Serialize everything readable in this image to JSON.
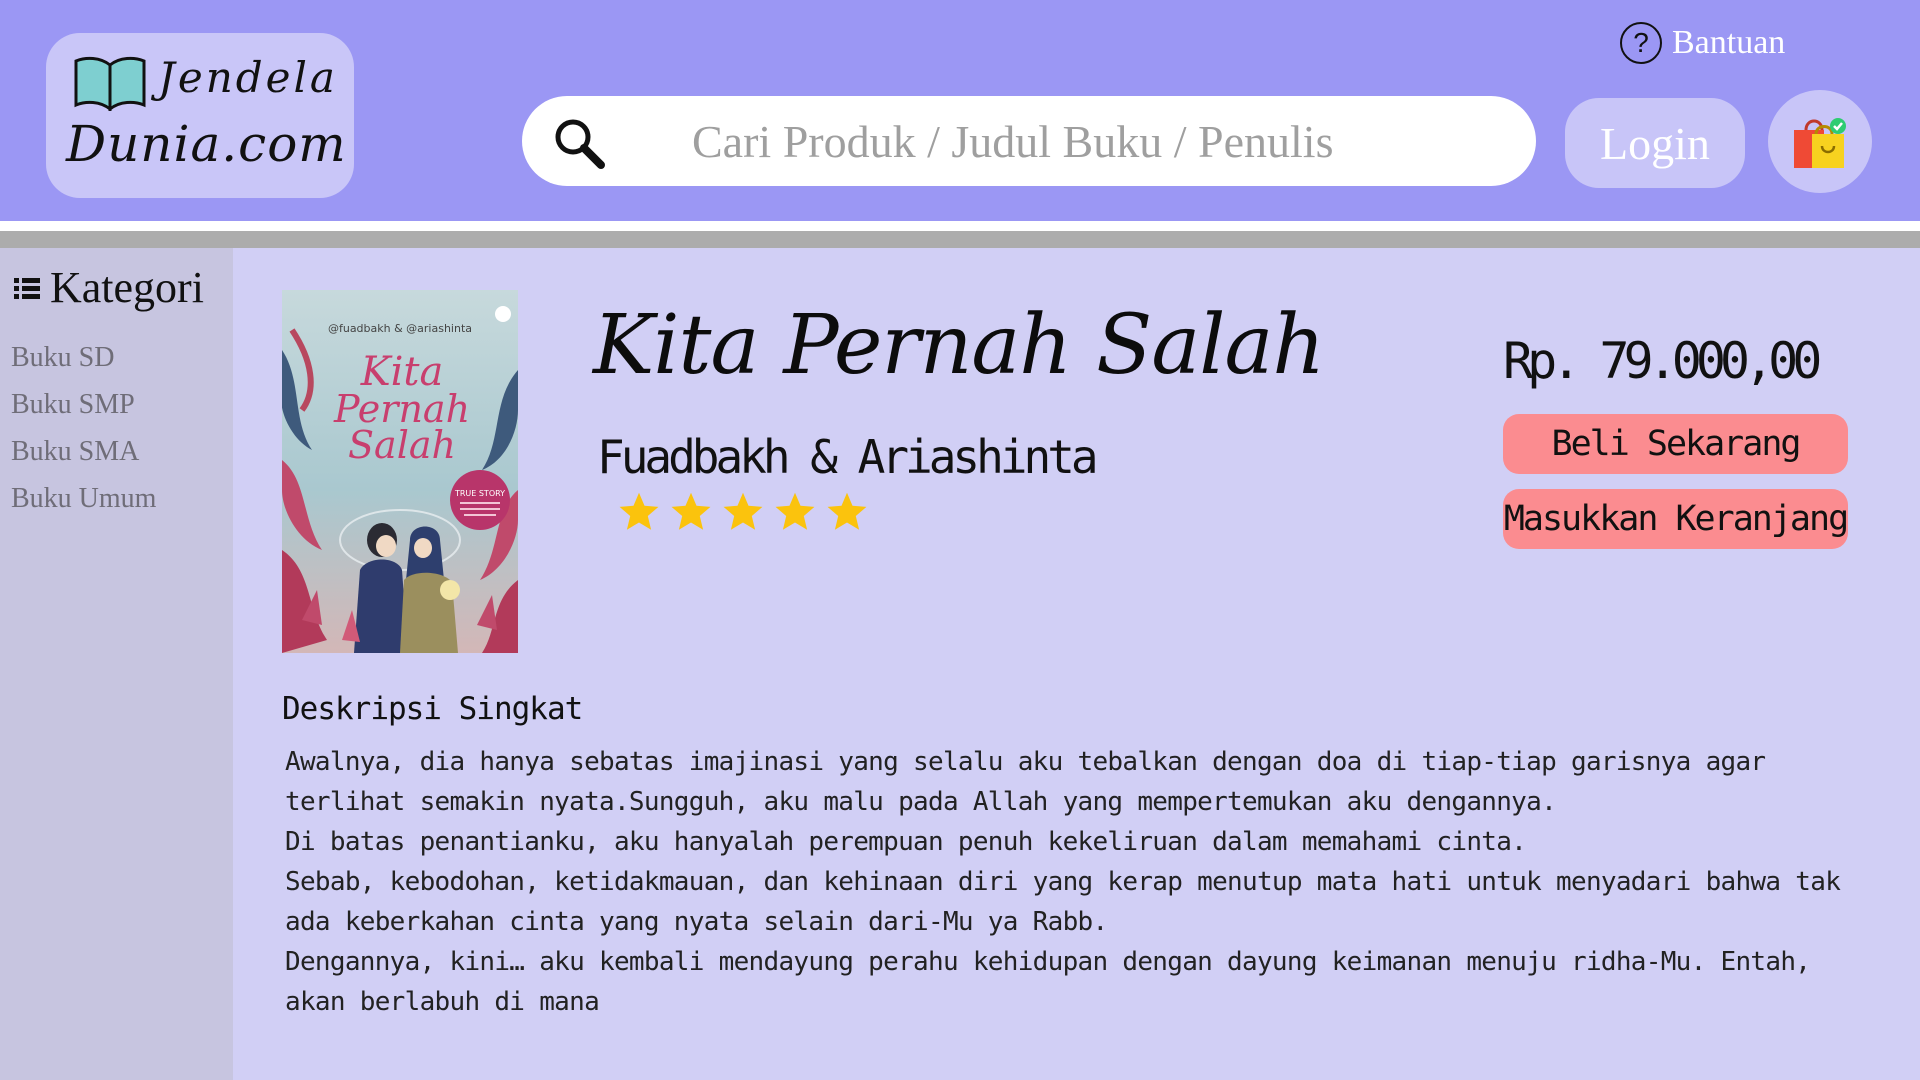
{
  "header": {
    "logo_line1": "Jendela",
    "logo_line2": "Dunia.com",
    "help_icon_glyph": "?",
    "help_label": "Bantuan",
    "search_placeholder": "Cari Produk / Judul Buku / Penulis",
    "login_label": "Login",
    "cart_icon": "shopping-bag-icon"
  },
  "sidebar": {
    "title": "Kategori",
    "items": [
      {
        "label": "Buku SD"
      },
      {
        "label": "Buku SMP"
      },
      {
        "label": "Buku SMA"
      },
      {
        "label": "Buku Umum"
      }
    ]
  },
  "product": {
    "title": "Kita Pernah Salah",
    "author": "Fuadbakh & Ariashinta",
    "rating": 5,
    "rating_max": 5,
    "price": "Rp. 79.000,00",
    "buy_label": "Beli Sekarang",
    "add_to_cart_label": "Masukkan Keranjang",
    "cover": {
      "authors_text": "@fuadbakh & @ariashinta",
      "title_line1": "Kita",
      "title_line2": "Pernah",
      "title_line3": "Salah",
      "badge_text": "TRUE STORY"
    }
  },
  "description": {
    "title": "Deskripsi Singkat",
    "paragraphs": [
      "Awalnya, dia hanya sebatas imajinasi yang selalu aku tebalkan dengan doa di tiap-tiap garisnya agar terlihat semakin nyata.Sungguh, aku malu pada Allah yang mempertemukan aku dengannya.",
      "Di batas penantianku, aku hanyalah perempuan penuh kekeliruan dalam memahami cinta.",
      "Sebab, kebodohan, ketidakmauan, dan kehinaan diri yang kerap menutup mata hati untuk menyadari bahwa tak ada keberkahan cinta yang nyata selain dari-Mu ya Rabb.",
      "Dengannya, kini… aku kembali mendayung perahu kehidupan dengan dayung keimanan menuju ridha-Mu. Entah, akan berlabuh di mana"
    ]
  },
  "colors": {
    "header_bg": "#9b97f4",
    "button_bg": "#c8c5f8",
    "sidebar_bg": "#c7c5e0",
    "main_bg": "#d1cff5",
    "action_button": "#fb8c90",
    "star": "#fbc30d"
  }
}
